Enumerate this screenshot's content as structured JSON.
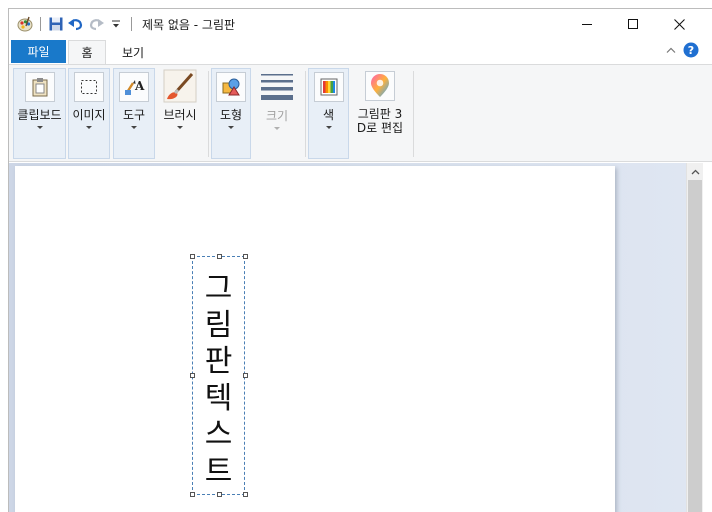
{
  "window": {
    "title": "제목 없음 - 그림판",
    "accent_color": "#1979ca"
  },
  "quick_access": {
    "icons": [
      "paint-app-icon",
      "save-icon",
      "undo-icon",
      "redo-icon",
      "customize-dropdown-icon"
    ]
  },
  "tabs": {
    "file": "파일",
    "home": "홈",
    "view": "보기"
  },
  "ribbon": {
    "clipboard": "클립보드",
    "image": "이미지",
    "tools": "도구",
    "brushes": "브러시",
    "shapes": "도형",
    "size": "크기",
    "colors": "색",
    "paint3d": "그림판 3\nD로 편집"
  },
  "canvas": {
    "text": "그림판 텍스트"
  }
}
